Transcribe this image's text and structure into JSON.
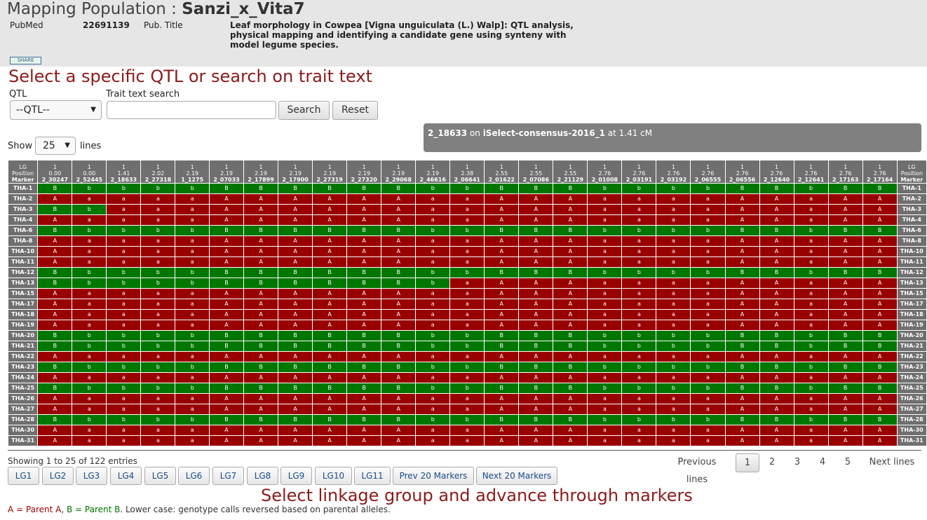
{
  "page_title_prefix": "Mapping Population : ",
  "page_title_name": "Sanzi_x_Vita7",
  "pubmed_label": "PubMed",
  "pubmed_id": "22691139",
  "pub_title_label": "Pub. Title",
  "pub_title_line1": "Leaf morphology in Cowpea [Vigna unguiculata (L.) Walp]: QTL analysis,",
  "pub_title_line2": "physical mapping and identifying a candidate gene using synteny with",
  "pub_title_line3": "model legume species.",
  "share_label": "SHARE",
  "instruction_top": "Select a specific QTL or search on trait text",
  "qtl_label": "QTL",
  "qtl_value": "--QTL--",
  "trait_label": "Trait text search",
  "trait_value": "",
  "search_btn": "Search",
  "reset_btn": "Reset",
  "show_label": "Show",
  "show_value": "25",
  "lines_label": "lines",
  "tooltip": {
    "marker": "2_18633",
    "on": " on ",
    "map": "iSelect-consensus-2016_1",
    "at": " at 1.41 cM"
  },
  "grid": {
    "head_lg": "LG",
    "head_pos": "Position",
    "head_marker": "Marker",
    "markers": [
      {
        "lg": "1",
        "pos": "0.00",
        "name": "2_30247"
      },
      {
        "lg": "1",
        "pos": "0.00",
        "name": "2_52445"
      },
      {
        "lg": "1",
        "pos": "1.41",
        "name": "2_18633"
      },
      {
        "lg": "1",
        "pos": "2.02",
        "name": "2_27318"
      },
      {
        "lg": "1",
        "pos": "2.19",
        "name": "1_1275"
      },
      {
        "lg": "1",
        "pos": "2.19",
        "name": "2_07033"
      },
      {
        "lg": "1",
        "pos": "2.19",
        "name": "2_17899"
      },
      {
        "lg": "1",
        "pos": "2.19",
        "name": "2_17900"
      },
      {
        "lg": "1",
        "pos": "2.19",
        "name": "2_27319"
      },
      {
        "lg": "1",
        "pos": "2.19",
        "name": "2_27320"
      },
      {
        "lg": "1",
        "pos": "2.19",
        "name": "2_29068"
      },
      {
        "lg": "1",
        "pos": "2.19",
        "name": "2_46616"
      },
      {
        "lg": "1",
        "pos": "2.38",
        "name": "2_06641"
      },
      {
        "lg": "1",
        "pos": "2.55",
        "name": "2_01622"
      },
      {
        "lg": "1",
        "pos": "2.55",
        "name": "2_07086"
      },
      {
        "lg": "1",
        "pos": "2.55",
        "name": "2_21129"
      },
      {
        "lg": "1",
        "pos": "2.76",
        "name": "2_01008"
      },
      {
        "lg": "1",
        "pos": "2.76",
        "name": "2_03191"
      },
      {
        "lg": "1",
        "pos": "2.76",
        "name": "2_03192"
      },
      {
        "lg": "1",
        "pos": "2.76",
        "name": "2_06555"
      },
      {
        "lg": "1",
        "pos": "2.76",
        "name": "2_06556"
      },
      {
        "lg": "1",
        "pos": "2.76",
        "name": "2_12640"
      },
      {
        "lg": "1",
        "pos": "2.76",
        "name": "2_12641"
      },
      {
        "lg": "1",
        "pos": "2.76",
        "name": "2_17163"
      },
      {
        "lg": "1",
        "pos": "2.76",
        "name": "2_17164"
      }
    ],
    "rows": [
      {
        "line": "THA-1",
        "calls": "BbbbbBBBBBBbbBBBbbbbBBbBB"
      },
      {
        "line": "THA-2",
        "calls": "AaaaaAAAAAAaaAAAaaaaAAaAA"
      },
      {
        "line": "THA-3",
        "calls": "BbaaaAAAAAAaaAAAaaaaAAaAA"
      },
      {
        "line": "THA-4",
        "calls": "AaaaaAAAAAAaaAAAaaaaAAaAA"
      },
      {
        "line": "THA-6",
        "calls": "BbbbbBBBBBBbbBBBbbbbBBbBB"
      },
      {
        "line": "THA-8",
        "calls": "AaaaaAAAAAAaaAAAaaaaAAaAA"
      },
      {
        "line": "THA-10",
        "calls": "AaaaaAAAAAAaaAAAaaaaAAaAA"
      },
      {
        "line": "THA-11",
        "calls": "AaaaaAAAAAAaaAAAaaaaAAaAA"
      },
      {
        "line": "THA-12",
        "calls": "BbbbbBBBBBBbbBBBbbbbBBbBB"
      },
      {
        "line": "THA-13",
        "calls": "BbbbbBBBBBBbaAAAaaaaAAaAA"
      },
      {
        "line": "THA-15",
        "calls": "AaaaaAAAAAAaaAAAaaaaAAaAA"
      },
      {
        "line": "THA-17",
        "calls": "AaaaaAAAAAAaaAAAaaaaAAaAA"
      },
      {
        "line": "THA-18",
        "calls": "AaaaaAAAAAAaaAAAaaaaAAaAA"
      },
      {
        "line": "THA-19",
        "calls": "AaaaaAAAAAAaaAAAaaaaAAaAA"
      },
      {
        "line": "THA-20",
        "calls": "BbbbbBBBBBBbbBBBbbbbBBbBB"
      },
      {
        "line": "THA-21",
        "calls": "BbbbbBBBBBBbbBBBbbbbBBbBB"
      },
      {
        "line": "THA-22",
        "calls": "AaaaaAAAAAAaaAAAaaaaAAaAA"
      },
      {
        "line": "THA-23",
        "calls": "BbbbbBBBBBBbbBBBbbbbBBbBB"
      },
      {
        "line": "THA-24",
        "calls": "AaaaaAAAAAAaaAAAaaaaAAaAA"
      },
      {
        "line": "THA-25",
        "calls": "BbbbbBBBBBBbbBBBbbbbBBbBB"
      },
      {
        "line": "THA-26",
        "calls": "AaaaaAAAAAAaaAAAaaaaAAaAA"
      },
      {
        "line": "THA-27",
        "calls": "AaaaaAAAAAAaaAAAaaaaAAaAA"
      },
      {
        "line": "THA-28",
        "calls": "BbbbbBBBBBBbbBBBbbbbBBbBB"
      },
      {
        "line": "THA-30",
        "calls": "AaaaaAAAAAAaaAAAaaaaAAaAA"
      },
      {
        "line": "THA-31",
        "calls": "AaaaaAAAAAAaaAAAaaaaAAaAA"
      }
    ]
  },
  "showing_text": "Showing 1 to 25 of 122 entries",
  "pagination": {
    "prev": "Previous lines",
    "pages": [
      "1",
      "2",
      "3",
      "4",
      "5"
    ],
    "current": "1",
    "next": "Next lines"
  },
  "lg_buttons": [
    "LG1",
    "LG2",
    "LG3",
    "LG4",
    "LG5",
    "LG6",
    "LG7",
    "LG8",
    "LG9",
    "LG10",
    "LG11"
  ],
  "prev_markers": "Prev 20 Markers",
  "next_markers": "Next 20 Markers",
  "instruction_bottom": "Select linkage group and advance through markers",
  "legend": {
    "a": "A = Parent A",
    "sep": ", ",
    "b": "B = Parent B",
    "rest": ". Lower case: genotype calls reversed based on parental alleles."
  },
  "colors": {
    "parent_a": "#990000",
    "parent_b": "#007700",
    "header_gray": "#6f6f6f",
    "instruction_red": "#8b1a1a"
  }
}
